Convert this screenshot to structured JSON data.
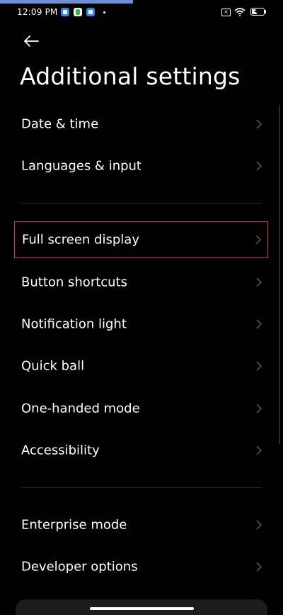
{
  "status_bar": {
    "time": "12:09 PM",
    "notification_icons": [
      "blue-app-icon",
      "green-app-icon",
      "blue-app-icon"
    ],
    "sim_icon": "no-sim-icon",
    "wifi_icon": "wifi-icon",
    "battery_level": "40"
  },
  "header": {
    "back_icon": "arrow-left-icon",
    "title": "Additional settings"
  },
  "colors": {
    "background": "#000000",
    "text": "#ffffff",
    "chevron": "#5a5a5a",
    "divider": "#262626",
    "highlight": "#e0313b"
  },
  "settings": {
    "group1": [
      {
        "label": "Date & time"
      },
      {
        "label": "Languages & input"
      }
    ],
    "group2": [
      {
        "label": "Full screen display",
        "highlighted": true
      },
      {
        "label": "Button shortcuts"
      },
      {
        "label": "Notification light"
      },
      {
        "label": "Quick ball"
      },
      {
        "label": "One-handed mode"
      },
      {
        "label": "Accessibility"
      }
    ],
    "group3": [
      {
        "label": "Enterprise mode"
      },
      {
        "label": "Developer options"
      }
    ]
  }
}
